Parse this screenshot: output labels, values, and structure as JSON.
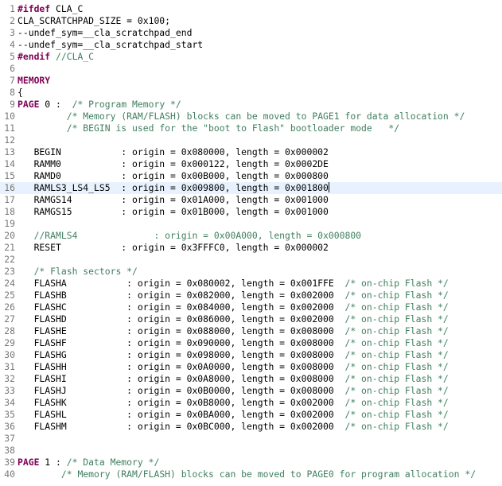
{
  "editor": {
    "current_line": 16,
    "lines": [
      {
        "num": "1",
        "segments": [
          {
            "cls": "kw",
            "text": "#ifdef"
          },
          {
            "cls": "txt",
            "text": " CLA_C"
          }
        ]
      },
      {
        "num": "2",
        "segments": [
          {
            "cls": "txt",
            "text": "CLA_SCRATCHPAD_SIZE = 0x100;"
          }
        ]
      },
      {
        "num": "3",
        "segments": [
          {
            "cls": "txt",
            "text": "--undef_sym=__cla_scratchpad_end"
          }
        ]
      },
      {
        "num": "4",
        "segments": [
          {
            "cls": "txt",
            "text": "--undef_sym=__cla_scratchpad_start"
          }
        ]
      },
      {
        "num": "5",
        "segments": [
          {
            "cls": "kw",
            "text": "#endif"
          },
          {
            "cls": "cm",
            "text": " //CLA_C"
          }
        ]
      },
      {
        "num": "6",
        "segments": []
      },
      {
        "num": "7",
        "segments": [
          {
            "cls": "kw",
            "text": "MEMORY"
          }
        ]
      },
      {
        "num": "8",
        "segments": [
          {
            "cls": "txt",
            "text": "{"
          }
        ]
      },
      {
        "num": "9",
        "segments": [
          {
            "cls": "kw",
            "text": "PAGE"
          },
          {
            "cls": "txt",
            "text": " 0 :  "
          },
          {
            "cls": "cm",
            "text": "/* Program Memory */"
          }
        ]
      },
      {
        "num": "10",
        "segments": [
          {
            "cls": "txt",
            "text": "         "
          },
          {
            "cls": "cm",
            "text": "/* Memory (RAM/FLASH) blocks can be moved to PAGE1 for data allocation */"
          }
        ]
      },
      {
        "num": "11",
        "segments": [
          {
            "cls": "txt",
            "text": "         "
          },
          {
            "cls": "cm",
            "text": "/* BEGIN is used for the \"boot to Flash\" bootloader mode   */"
          }
        ]
      },
      {
        "num": "12",
        "segments": []
      },
      {
        "num": "13",
        "segments": [
          {
            "cls": "txt",
            "text": "   BEGIN           : origin = 0x080000, length = 0x000002"
          }
        ]
      },
      {
        "num": "14",
        "segments": [
          {
            "cls": "txt",
            "text": "   RAMM0           : origin = 0x000122, length = 0x0002DE"
          }
        ]
      },
      {
        "num": "15",
        "segments": [
          {
            "cls": "txt",
            "text": "   RAMD0           : origin = 0x00B000, length = 0x000800"
          }
        ]
      },
      {
        "num": "16",
        "segments": [
          {
            "cls": "txt",
            "text": "   RAMLS3_LS4_LS5  : origin = 0x009800, length = 0x001800"
          },
          {
            "cls": "caret",
            "text": ""
          }
        ]
      },
      {
        "num": "17",
        "segments": [
          {
            "cls": "txt",
            "text": "   RAMGS14         : origin = 0x01A000, length = 0x001000"
          }
        ]
      },
      {
        "num": "18",
        "segments": [
          {
            "cls": "txt",
            "text": "   RAMGS15         : origin = 0x01B000, length = 0x001000"
          }
        ]
      },
      {
        "num": "19",
        "segments": []
      },
      {
        "num": "20",
        "segments": [
          {
            "cls": "txt",
            "text": "   "
          },
          {
            "cls": "cm",
            "text": "//RAMLS4              : origin = 0x00A000, length = 0x000800"
          }
        ]
      },
      {
        "num": "21",
        "segments": [
          {
            "cls": "txt",
            "text": "   RESET           : origin = 0x3FFFC0, length = 0x000002"
          }
        ]
      },
      {
        "num": "22",
        "segments": []
      },
      {
        "num": "23",
        "segments": [
          {
            "cls": "txt",
            "text": "   "
          },
          {
            "cls": "cm",
            "text": "/* Flash sectors */"
          }
        ]
      },
      {
        "num": "24",
        "segments": [
          {
            "cls": "txt",
            "text": "   FLASHA           : origin = 0x080002, length = 0x001FFE  "
          },
          {
            "cls": "cm",
            "text": "/* on-chip Flash */"
          }
        ]
      },
      {
        "num": "25",
        "segments": [
          {
            "cls": "txt",
            "text": "   FLASHB           : origin = 0x082000, length = 0x002000  "
          },
          {
            "cls": "cm",
            "text": "/* on-chip Flash */"
          }
        ]
      },
      {
        "num": "26",
        "segments": [
          {
            "cls": "txt",
            "text": "   FLASHC           : origin = 0x084000, length = 0x002000  "
          },
          {
            "cls": "cm",
            "text": "/* on-chip Flash */"
          }
        ]
      },
      {
        "num": "27",
        "segments": [
          {
            "cls": "txt",
            "text": "   FLASHD           : origin = 0x086000, length = 0x002000  "
          },
          {
            "cls": "cm",
            "text": "/* on-chip Flash */"
          }
        ]
      },
      {
        "num": "28",
        "segments": [
          {
            "cls": "txt",
            "text": "   FLASHE           : origin = 0x088000, length = 0x008000  "
          },
          {
            "cls": "cm",
            "text": "/* on-chip Flash */"
          }
        ]
      },
      {
        "num": "29",
        "segments": [
          {
            "cls": "txt",
            "text": "   FLASHF           : origin = 0x090000, length = 0x008000  "
          },
          {
            "cls": "cm",
            "text": "/* on-chip Flash */"
          }
        ]
      },
      {
        "num": "30",
        "segments": [
          {
            "cls": "txt",
            "text": "   FLASHG           : origin = 0x098000, length = 0x008000  "
          },
          {
            "cls": "cm",
            "text": "/* on-chip Flash */"
          }
        ]
      },
      {
        "num": "31",
        "segments": [
          {
            "cls": "txt",
            "text": "   FLASHH           : origin = 0x0A0000, length = 0x008000  "
          },
          {
            "cls": "cm",
            "text": "/* on-chip Flash */"
          }
        ]
      },
      {
        "num": "32",
        "segments": [
          {
            "cls": "txt",
            "text": "   FLASHI           : origin = 0x0A8000, length = 0x008000  "
          },
          {
            "cls": "cm",
            "text": "/* on-chip Flash */"
          }
        ]
      },
      {
        "num": "33",
        "segments": [
          {
            "cls": "txt",
            "text": "   FLASHJ           : origin = 0x0B0000, length = 0x008000  "
          },
          {
            "cls": "cm",
            "text": "/* on-chip Flash */"
          }
        ]
      },
      {
        "num": "34",
        "segments": [
          {
            "cls": "txt",
            "text": "   FLASHK           : origin = 0x0B8000, length = 0x002000  "
          },
          {
            "cls": "cm",
            "text": "/* on-chip Flash */"
          }
        ]
      },
      {
        "num": "35",
        "segments": [
          {
            "cls": "txt",
            "text": "   FLASHL           : origin = 0x0BA000, length = 0x002000  "
          },
          {
            "cls": "cm",
            "text": "/* on-chip Flash */"
          }
        ]
      },
      {
        "num": "36",
        "segments": [
          {
            "cls": "txt",
            "text": "   FLASHM           : origin = 0x0BC000, length = 0x002000  "
          },
          {
            "cls": "cm",
            "text": "/* on-chip Flash */"
          }
        ]
      },
      {
        "num": "37",
        "segments": []
      },
      {
        "num": "38",
        "segments": []
      },
      {
        "num": "39",
        "segments": [
          {
            "cls": "kw",
            "text": "PAGE"
          },
          {
            "cls": "txt",
            "text": " 1 : "
          },
          {
            "cls": "cm",
            "text": "/* Data Memory */"
          }
        ]
      },
      {
        "num": "40",
        "segments": [
          {
            "cls": "txt",
            "text": "        "
          },
          {
            "cls": "cm",
            "text": "/* Memory (RAM/FLASH) blocks can be moved to PAGE0 for program allocation */"
          }
        ]
      }
    ]
  }
}
